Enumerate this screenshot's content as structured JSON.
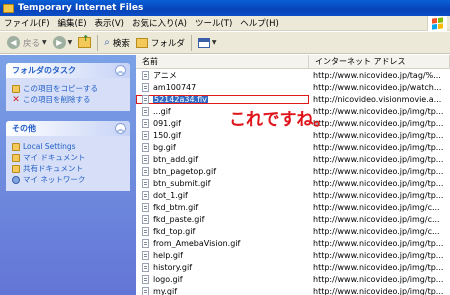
{
  "window": {
    "title": "Temporary Internet Files"
  },
  "menu": [
    "ファイル(F)",
    "編集(E)",
    "表示(V)",
    "お気に入り(A)",
    "ツール(T)",
    "ヘルプ(H)"
  ],
  "toolbar": {
    "back": "戻る",
    "search": "検索",
    "folders": "フォルダ"
  },
  "tasks_panel": {
    "title": "フォルダのタスク",
    "items": [
      "この項目をコピーする",
      "この項目を削除する"
    ]
  },
  "other_panel": {
    "title": "その他",
    "items": [
      "Local Settings",
      "マイ ドキュメント",
      "共有ドキュメント",
      "マイ ネットワーク"
    ]
  },
  "columns": {
    "name": "名前",
    "address": "インターネット アドレス"
  },
  "files": [
    {
      "name": "アニメ",
      "address": "http://www.nicovideo.jp/tag/%..."
    },
    {
      "name": "am100747",
      "address": "http://www.nicovideo.jp/watch..."
    },
    {
      "name": "52142a34.flv",
      "address": "http://nicovideo.visionmovie.a..."
    },
    {
      "name": "...gif",
      "address": "http://www.nicovideo.jp/img/tp..."
    },
    {
      "name": "091.gif",
      "address": "http://www.nicovideo.jp/img/tp..."
    },
    {
      "name": "150.gif",
      "address": "http://www.nicovideo.jp/img/tp..."
    },
    {
      "name": "bg.gif",
      "address": "http://www.nicovideo.jp/img/tp..."
    },
    {
      "name": "btn_add.gif",
      "address": "http://www.nicovideo.jp/img/tp..."
    },
    {
      "name": "btn_pagetop.gif",
      "address": "http://www.nicovideo.jp/img/tp..."
    },
    {
      "name": "btn_submit.gif",
      "address": "http://www.nicovideo.jp/img/tp..."
    },
    {
      "name": "dot_1.gif",
      "address": "http://www.nicovideo.jp/img/tp..."
    },
    {
      "name": "fkd_btm.gif",
      "address": "http://www.nicovideo.jp/img/c..."
    },
    {
      "name": "fkd_paste.gif",
      "address": "http://www.nicovideo.jp/img/c..."
    },
    {
      "name": "fkd_top.gif",
      "address": "http://www.nicovideo.jp/img/c..."
    },
    {
      "name": "from_AmebaVision.gif",
      "address": "http://www.nicovideo.jp/img/tp..."
    },
    {
      "name": "help.gif",
      "address": "http://www.nicovideo.jp/img/tp..."
    },
    {
      "name": "history.gif",
      "address": "http://www.nicovideo.jp/img/tp..."
    },
    {
      "name": "logo.gif",
      "address": "http://www.nicovideo.jp/img/tp..."
    },
    {
      "name": "my.gif",
      "address": "http://www.nicovideo.jp/img/tp..."
    }
  ],
  "highlighted_file": "52142a34.flv",
  "annotation": "これですね。",
  "colors": {
    "titlebar": "#0a4fc8",
    "task_link": "#215dc6",
    "annotation": "#e0141b"
  }
}
